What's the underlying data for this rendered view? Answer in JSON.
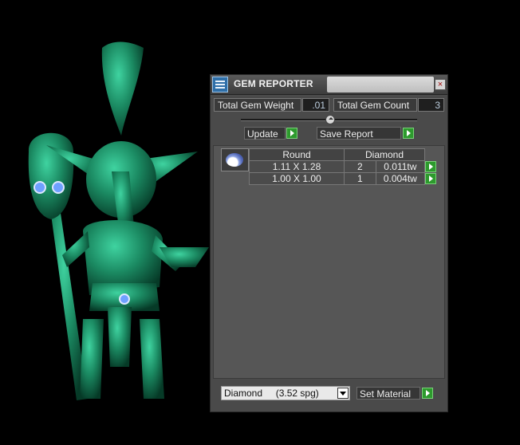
{
  "panel": {
    "title": "GEM REPORTER",
    "close_label": "×",
    "total_weight_label": "Total Gem Weight",
    "total_weight_value": ".01",
    "total_count_label": "Total Gem Count",
    "total_count_value": "3",
    "update_label": "Update",
    "save_report_label": "Save Report",
    "table": {
      "headers": [
        "Round",
        "Diamond"
      ],
      "rows": [
        {
          "size": "1.11 X 1.28",
          "count": "2",
          "weight": "0.011tw"
        },
        {
          "size": "1.00 X 1.00",
          "count": "1",
          "weight": "0.004tw"
        }
      ]
    },
    "material_select": {
      "name": "Diamond",
      "detail": "(3.52 spg)"
    },
    "set_material_label": "Set Material"
  },
  "colors": {
    "model": "#1c8a63",
    "accent_play": "#2d9a2d"
  }
}
